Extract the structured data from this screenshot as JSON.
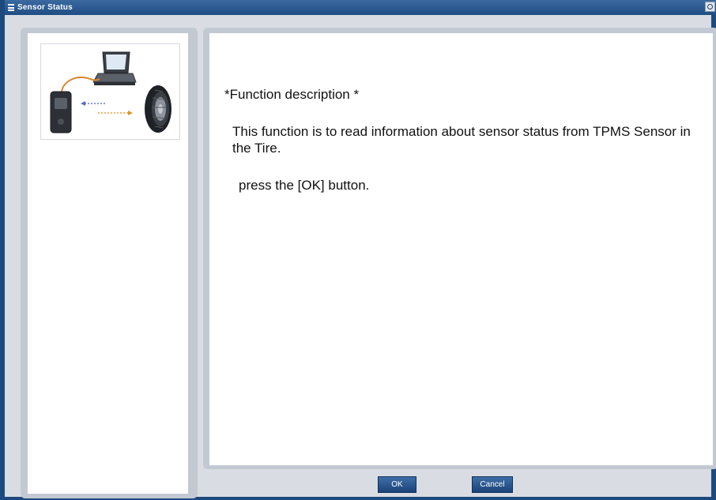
{
  "window": {
    "title": "Sensor Status"
  },
  "illustration": {
    "icons": [
      "tpms-tool-icon",
      "laptop-icon",
      "tire-icon",
      "signal-arrows-icon"
    ]
  },
  "description": {
    "title": "*Function description *",
    "body": "This function is to read information about sensor status from TPMS Sensor in the Tire.",
    "hint": "press the [OK] button."
  },
  "buttons": {
    "ok": "OK",
    "cancel": "Cancel"
  },
  "colors": {
    "titlebar": "#1f4d83",
    "frame": "#1d4a7e",
    "panel": "#c3c9d2",
    "button": "#2a5a92"
  }
}
